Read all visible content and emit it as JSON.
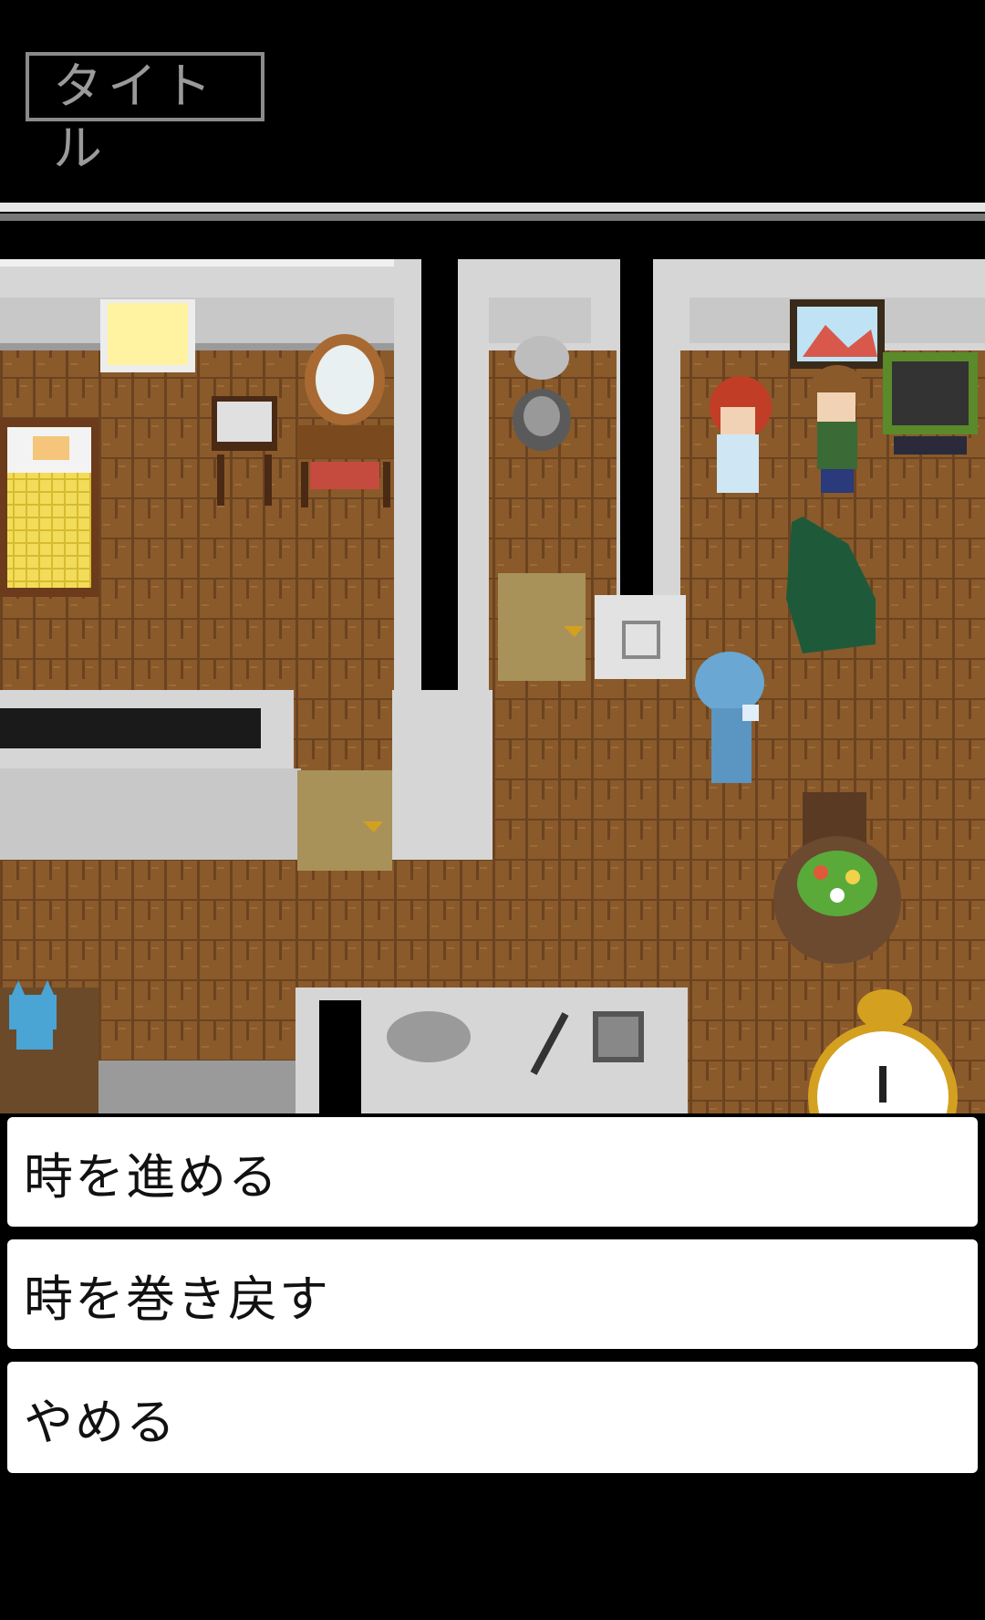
{
  "header": {
    "title_button": "タイトル"
  },
  "menu": {
    "options": [
      {
        "label": "時を進める"
      },
      {
        "label": "時を巻き戻す"
      },
      {
        "label": "やめる"
      }
    ]
  },
  "colors": {
    "background": "#000000",
    "floor": "#8a5a2b",
    "wall": "#d6d6d6",
    "menu_bg": "#ffffff",
    "title_border": "#8a8a8a"
  }
}
